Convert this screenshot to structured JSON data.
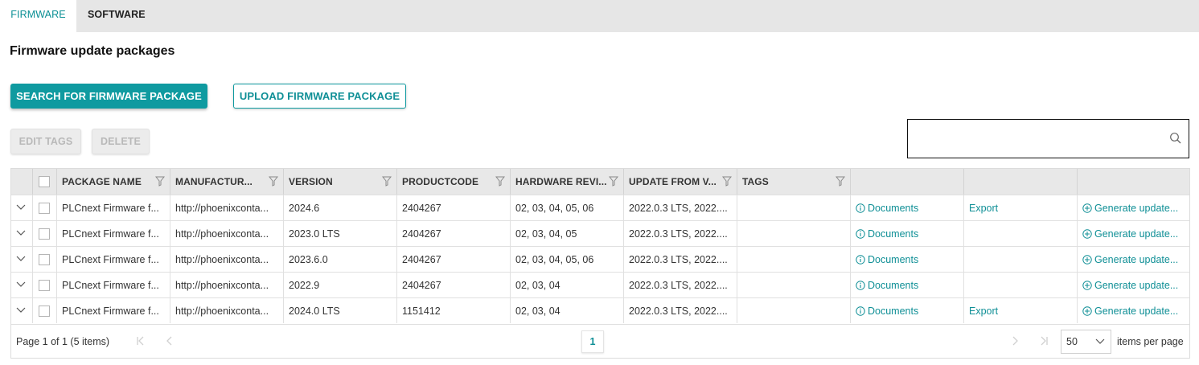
{
  "tabs": [
    {
      "label": "FIRMWARE",
      "active": true
    },
    {
      "label": "SOFTWARE",
      "active": false
    }
  ],
  "page_title": "Firmware update packages",
  "actions": {
    "search_package": "SEARCH FOR FIRMWARE PACKAGE",
    "upload_package": "UPLOAD FIRMWARE PACKAGE",
    "edit_tags": "EDIT TAGS",
    "delete": "DELETE"
  },
  "search": {
    "value": "",
    "icon": "search-icon"
  },
  "table": {
    "columns": [
      {
        "key": "name",
        "label": "PACKAGE NAME",
        "filter": true
      },
      {
        "key": "manufacturer",
        "label": "MANUFACTUR...",
        "filter": true
      },
      {
        "key": "version",
        "label": "VERSION",
        "filter": true
      },
      {
        "key": "productcode",
        "label": "PRODUCTCODE",
        "filter": true
      },
      {
        "key": "hw_rev",
        "label": "HARDWARE REVI...",
        "filter": true
      },
      {
        "key": "update_from",
        "label": "UPDATE FROM V...",
        "filter": true
      },
      {
        "key": "tags",
        "label": "TAGS",
        "filter": true
      }
    ],
    "rows": [
      {
        "name": "PLCnext Firmware f...",
        "manufacturer": "http://phoenixconta...",
        "version": "2024.6",
        "productcode": "2404267",
        "hw_rev": "02, 03, 04, 05, 06",
        "update_from": "2022.0.3 LTS, 2022....",
        "tags": "",
        "documents": "Documents",
        "export": "Export",
        "generate": "Generate update..."
      },
      {
        "name": "PLCnext Firmware f...",
        "manufacturer": "http://phoenixconta...",
        "version": "2023.0 LTS",
        "productcode": "2404267",
        "hw_rev": "02, 03, 04, 05",
        "update_from": "2022.0.3 LTS, 2022....",
        "tags": "",
        "documents": "Documents",
        "export": "",
        "generate": "Generate update..."
      },
      {
        "name": "PLCnext Firmware f...",
        "manufacturer": "http://phoenixconta...",
        "version": "2023.6.0",
        "productcode": "2404267",
        "hw_rev": "02, 03, 04, 05, 06",
        "update_from": "2022.0.3 LTS, 2022....",
        "tags": "",
        "documents": "Documents",
        "export": "",
        "generate": "Generate update..."
      },
      {
        "name": "PLCnext Firmware f...",
        "manufacturer": "http://phoenixconta...",
        "version": "2022.9",
        "productcode": "2404267",
        "hw_rev": "02, 03, 04",
        "update_from": "2022.0.3 LTS, 2022....",
        "tags": "",
        "documents": "Documents",
        "export": "",
        "generate": "Generate update..."
      },
      {
        "name": "PLCnext Firmware f...",
        "manufacturer": "http://phoenixconta...",
        "version": "2024.0 LTS",
        "productcode": "1151412",
        "hw_rev": "02, 03, 04",
        "update_from": "2022.0.3 LTS, 2022....",
        "tags": "",
        "documents": "Documents",
        "export": "Export",
        "generate": "Generate update..."
      }
    ]
  },
  "pagination": {
    "info": "Page 1 of 1 (5 items)",
    "current_page": "1",
    "per_page": "50",
    "per_page_label": "items per page"
  },
  "colors": {
    "accent": "#0f9aa0",
    "tab_bar": "#e6e6e6",
    "header_bg": "#e8e8e8"
  }
}
